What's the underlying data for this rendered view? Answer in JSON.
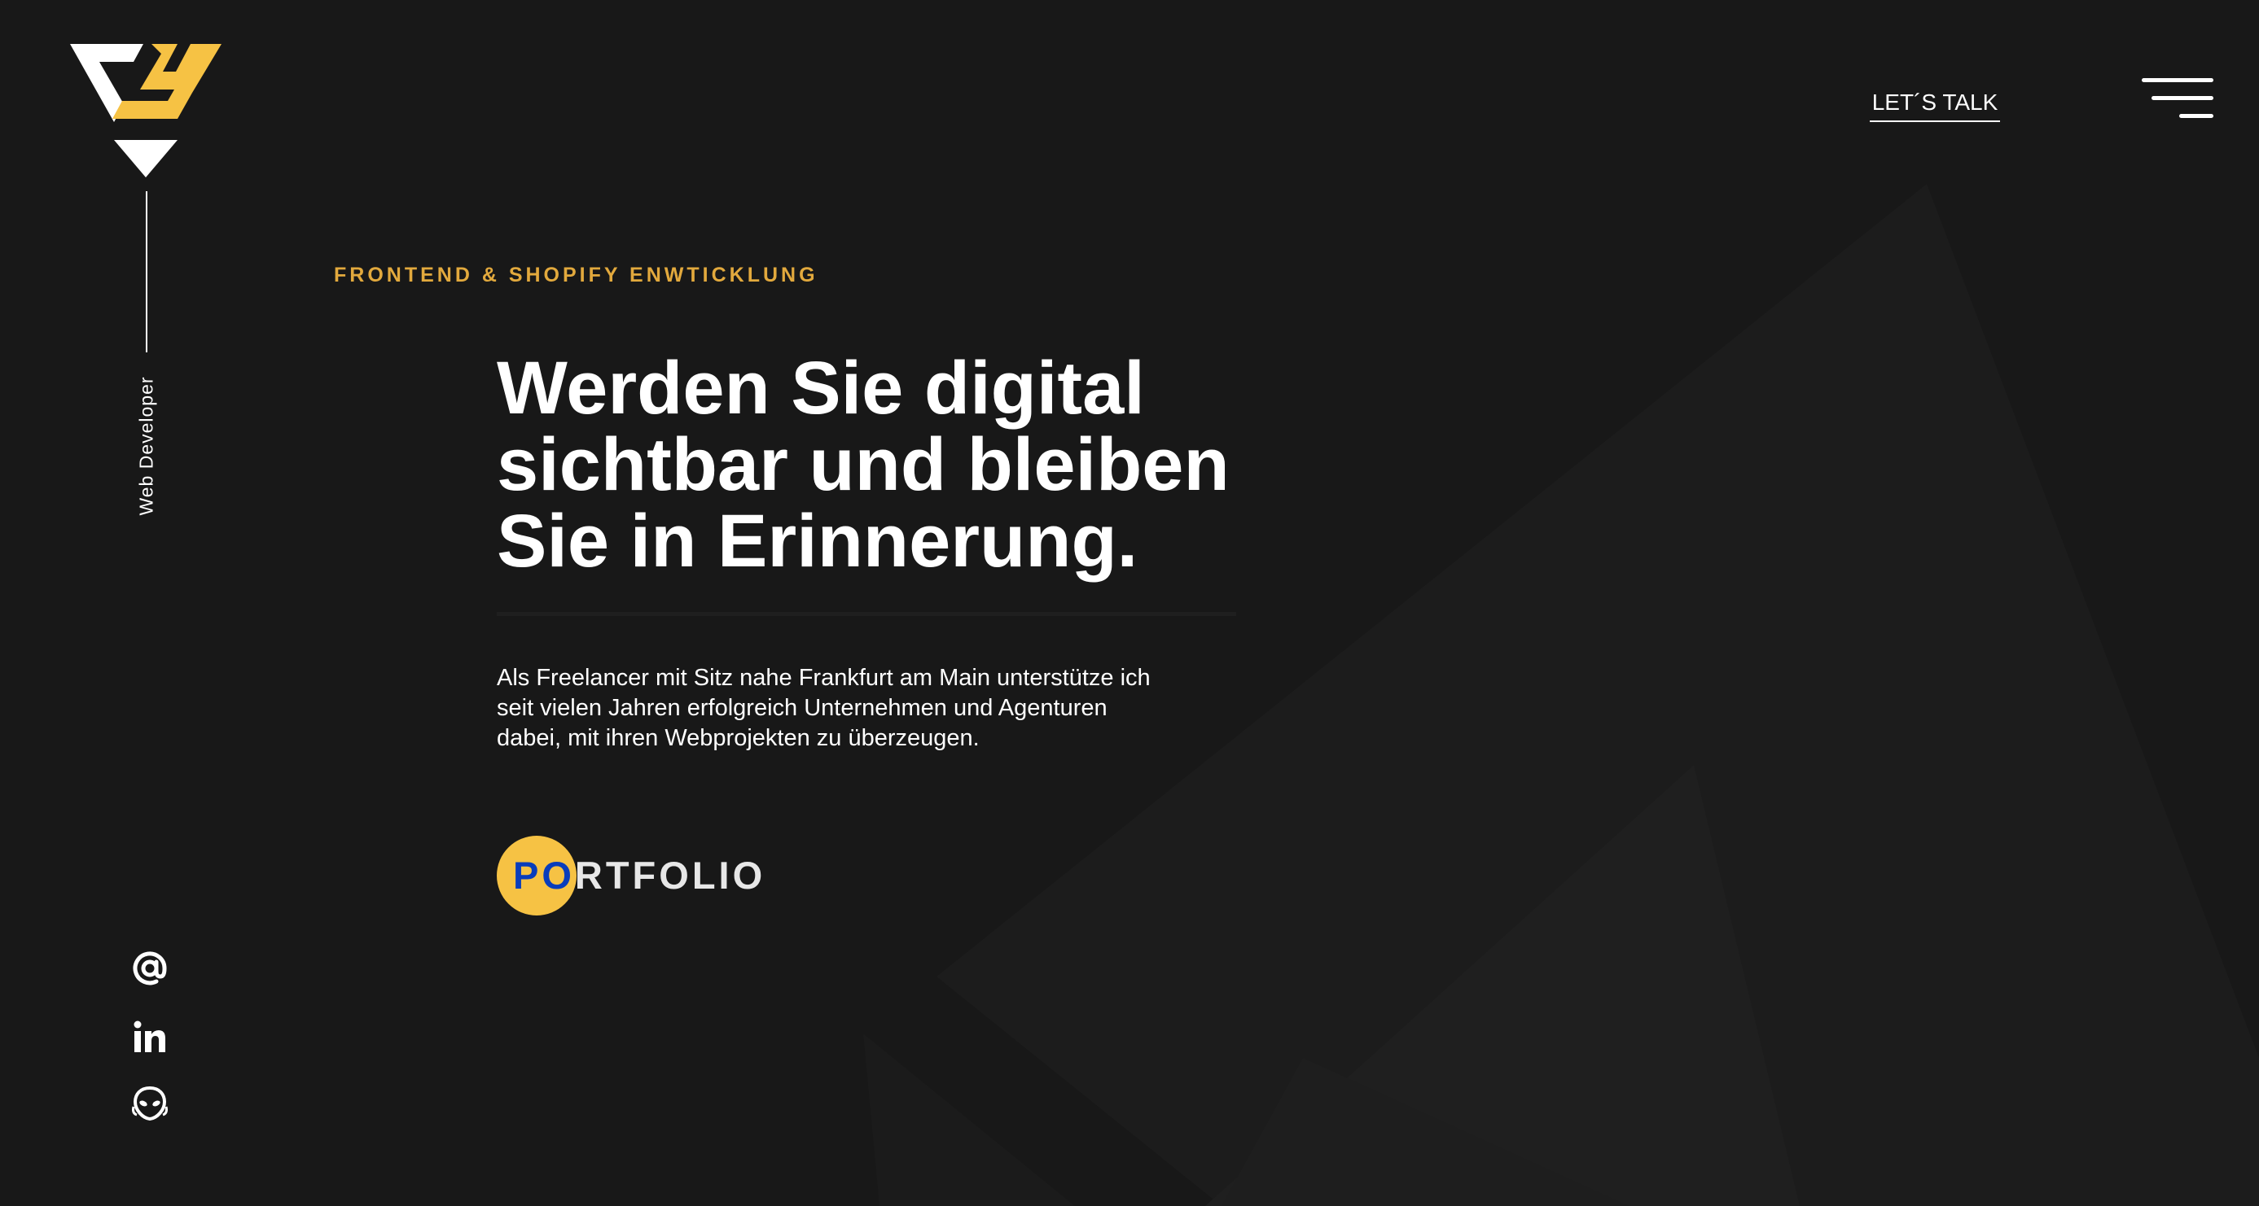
{
  "brand": {
    "logo_icon": "triangle-j-logo-icon",
    "accent_color": "#f6c244",
    "eyebrow_color": "#e2a93d",
    "background_color": "#181818"
  },
  "sidebar": {
    "vertical_label": "Web Developer",
    "social": [
      {
        "icon": "at-sign-icon"
      },
      {
        "icon": "linkedin-icon"
      },
      {
        "icon": "alien-face-icon"
      }
    ]
  },
  "header": {
    "cta_label": "LET´S TALK",
    "menu_icon": "hamburger-menu-icon"
  },
  "hero": {
    "eyebrow": "FRONTEND & SHOPIFY ENWTICKLUNG",
    "headline_line1": "Werden Sie digital",
    "headline_line2": "sichtbar und bleiben",
    "headline_line3": "Sie in Erinnerung.",
    "intro_line1": "Als Freelancer mit Sitz nahe Frankfurt am Main unterstütze ich",
    "intro_line2": "seit vielen Jahren erfolgreich Unternehmen und Agenturen",
    "intro_line3": "dabei, mit ihren Webprojekten zu überzeugen.",
    "portfolio_label": "PORTFOLIO"
  }
}
